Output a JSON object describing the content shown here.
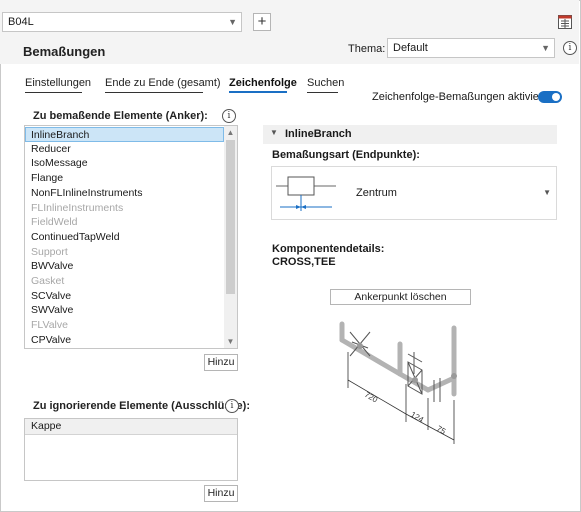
{
  "top": {
    "project_value": "B04L",
    "add_label": "+"
  },
  "header": {
    "title": "Bemaßungen",
    "theme_label": "Thema:",
    "theme_value": "Default"
  },
  "tabs": [
    {
      "label": "Einstellungen",
      "active": false
    },
    {
      "label": "Ende zu Ende (gesamt)",
      "active": false
    },
    {
      "label": "Zeichenfolge",
      "active": true
    },
    {
      "label": "Suchen",
      "active": false
    }
  ],
  "toggle": {
    "label": "Zeichenfolge-Bemaßungen aktivieren:",
    "on": true
  },
  "anchors": {
    "label": "Zu bemaßende Elemente (Anker):",
    "items": [
      {
        "text": "InlineBranch",
        "state": "selected"
      },
      {
        "text": "Reducer",
        "state": "normal"
      },
      {
        "text": "IsoMessage",
        "state": "normal"
      },
      {
        "text": "Flange",
        "state": "normal"
      },
      {
        "text": "NonFLInlineInstruments",
        "state": "normal"
      },
      {
        "text": "FLInlineInstruments",
        "state": "disabled"
      },
      {
        "text": "FieldWeld",
        "state": "disabled"
      },
      {
        "text": "ContinuedTapWeld",
        "state": "normal"
      },
      {
        "text": "Support",
        "state": "disabled"
      },
      {
        "text": "BWValve",
        "state": "normal"
      },
      {
        "text": "Gasket",
        "state": "disabled"
      },
      {
        "text": "SCValve",
        "state": "normal"
      },
      {
        "text": "SWValve",
        "state": "normal"
      },
      {
        "text": "FLValve",
        "state": "disabled"
      },
      {
        "text": "CPValve",
        "state": "normal"
      }
    ],
    "add_button": "Hinzu"
  },
  "exclusions": {
    "label": "Zu ignorierende Elemente (Ausschlüsse):",
    "column_header": "Kappe",
    "add_button": "Hinzu"
  },
  "detail": {
    "section_title": "InlineBranch",
    "dim_type_label": "Bemaßungsart (Endpunkte):",
    "dim_type_value": "Zentrum",
    "components_label": "Komponentendetails:",
    "components_value": "CROSS,TEE",
    "delete_anchor_button": "Ankerpunkt löschen",
    "drawing_dims": [
      "720",
      "124",
      "75"
    ]
  },
  "colors": {
    "accent": "#1a6fc4",
    "selection": "#cce5f7",
    "disabled_text": "#a7a7a7",
    "pipe": "#b3b3b3"
  }
}
